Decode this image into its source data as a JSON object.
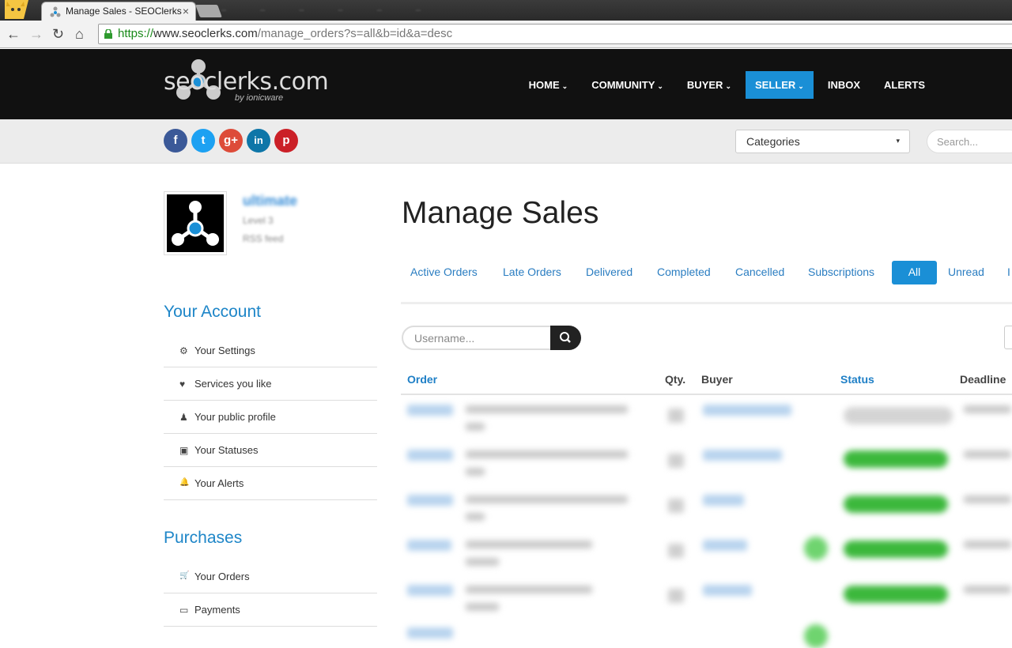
{
  "browser": {
    "tab_title": "Manage Sales - SEOClerks",
    "tab_close": "×",
    "url_scheme": "https://",
    "url_host": "www.seoclerks.com",
    "url_path": "/manage_orders?s=all&b=id&a=desc",
    "back": "←",
    "forward": "→",
    "reload": "↻",
    "home": "⌂"
  },
  "header": {
    "logo_text": "seoclerks.com",
    "logo_sub": "by ionicware",
    "nav": [
      {
        "label": "HOME",
        "caret": "⌄"
      },
      {
        "label": "COMMUNITY",
        "caret": "⌄"
      },
      {
        "label": "BUYER",
        "caret": "⌄"
      },
      {
        "label": "SELLER",
        "caret": "⌄"
      },
      {
        "label": "INBOX"
      },
      {
        "label": "ALERTS"
      }
    ],
    "active_nav": "SELLER",
    "accent": "#1a8fd6"
  },
  "subbar": {
    "social": [
      {
        "glyph": "f",
        "color": "#3b5998"
      },
      {
        "glyph": "t",
        "color": "#1da1f2"
      },
      {
        "glyph": "g+",
        "color": "#dd4b39"
      },
      {
        "glyph": "in",
        "color": "#0e76a8"
      },
      {
        "glyph": "p",
        "color": "#cb2027"
      }
    ],
    "categories_label": "Categories",
    "categories_caret": "▾",
    "search_placeholder": "Search..."
  },
  "profile": {
    "username": "ultimate",
    "level": "Level 3",
    "rss": "RSS feed"
  },
  "sidebar": {
    "account_heading": "Your Account",
    "account_items": [
      {
        "label": "Your Settings",
        "icon": "⚙"
      },
      {
        "label": "Services you like",
        "icon": "♥"
      },
      {
        "label": "Your public profile",
        "icon": "♟"
      },
      {
        "label": "Your Statuses",
        "icon": "▣"
      },
      {
        "label": "Your Alerts",
        "icon": "🔔"
      }
    ],
    "purchases_heading": "Purchases",
    "purchases_items": [
      {
        "label": "Your Orders",
        "icon": "🛒"
      },
      {
        "label": "Payments",
        "icon": "▭"
      }
    ]
  },
  "main": {
    "title": "Manage Sales",
    "tabs": [
      "Active Orders",
      "Late Orders",
      "Delivered",
      "Completed",
      "Cancelled",
      "Subscriptions",
      "All",
      "Unread",
      "I"
    ],
    "active_tab": "All",
    "username_placeholder": "Username...",
    "columns": [
      "Order",
      "Qty.",
      "Buyer",
      "Status",
      "Deadline"
    ],
    "status_color": "#3cb83c"
  }
}
